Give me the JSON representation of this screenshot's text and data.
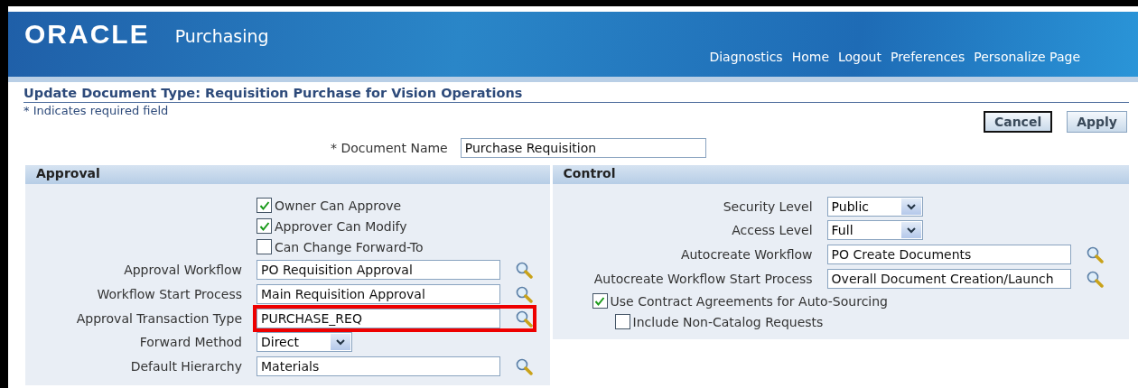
{
  "header": {
    "logo": "ORACLE",
    "product": "Purchasing",
    "links": [
      "Diagnostics",
      "Home",
      "Logout",
      "Preferences",
      "Personalize Page"
    ]
  },
  "page": {
    "title": "Update Document Type: Requisition Purchase for Vision Operations",
    "required_note": "* Indicates required field",
    "buttons": [
      {
        "label": "Cancel",
        "default": true
      },
      {
        "label": "Apply",
        "default": false
      }
    ],
    "document_name": {
      "label": "* Document Name",
      "value": "Purchase Requisition"
    }
  },
  "sections": [
    {
      "title": "Approval",
      "fields": [
        {
          "kind": "checkbox",
          "label": "Owner Can Approve",
          "checked": true
        },
        {
          "kind": "checkbox",
          "label": "Approver Can Modify",
          "checked": true
        },
        {
          "kind": "checkbox",
          "label": "Can Change Forward-To",
          "checked": false
        },
        {
          "kind": "lookup",
          "label": "Approval Workflow",
          "value": "PO Requisition Approval",
          "highlighted": false
        },
        {
          "kind": "lookup",
          "label": "Workflow Start Process",
          "value": "Main Requisition Approval",
          "highlighted": false
        },
        {
          "kind": "lookup",
          "label": "Approval Transaction Type",
          "value": "PURCHASE_REQ",
          "highlighted": true
        },
        {
          "kind": "select",
          "label": "Forward Method",
          "value": "Direct"
        },
        {
          "kind": "lookup",
          "label": "Default Hierarchy",
          "value": "Materials",
          "highlighted": false
        }
      ]
    },
    {
      "title": "Control",
      "fields": [
        {
          "kind": "select",
          "label": "Security Level",
          "value": "Public"
        },
        {
          "kind": "select",
          "label": "Access Level",
          "value": "Full"
        },
        {
          "kind": "lookup",
          "label": "Autocreate Workflow",
          "value": "PO Create Documents",
          "highlighted": false
        },
        {
          "kind": "lookup",
          "label": "Autocreate Workflow Start Process",
          "value": "Overall Document Creation/Launch",
          "highlighted": false
        },
        {
          "kind": "wide_checkbox",
          "label": "Use Contract Agreements for Auto-Sourcing",
          "checked": true
        },
        {
          "kind": "sub_checkbox",
          "label": "Include Non-Catalog Requests",
          "checked": false
        }
      ]
    }
  ]
}
